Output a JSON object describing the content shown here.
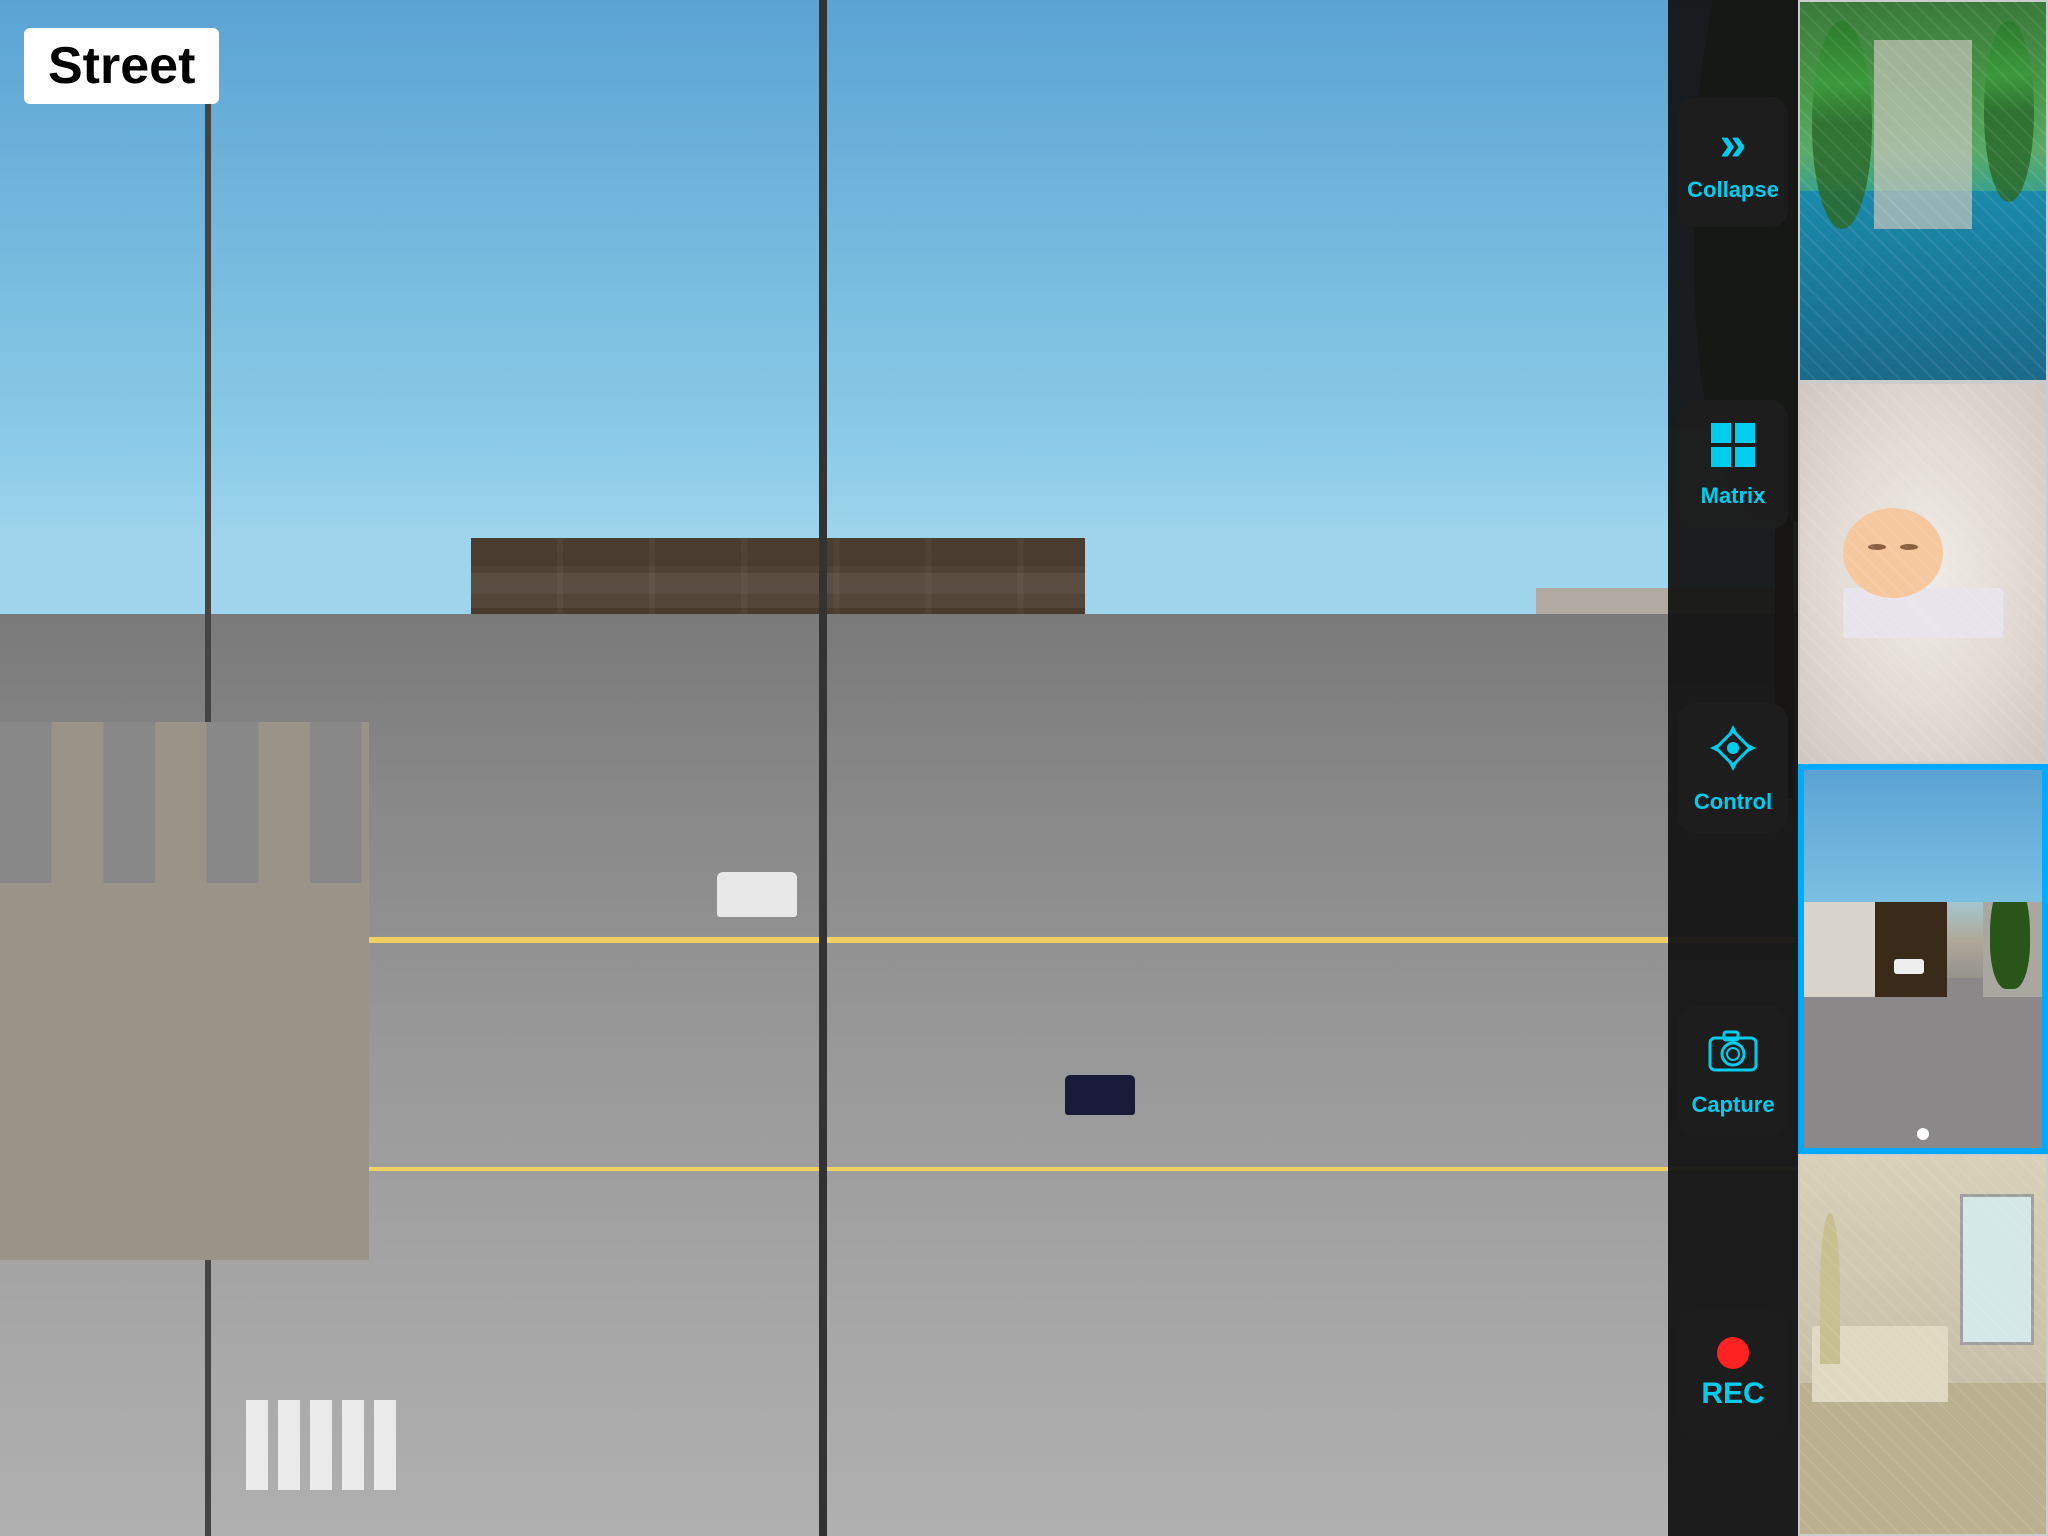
{
  "header": {
    "street_label": "Street"
  },
  "controls": [
    {
      "id": "collapse",
      "label": "Collapse",
      "icon": "chevron-right",
      "icon_unicode": "»"
    },
    {
      "id": "matrix",
      "label": "Matrix",
      "icon": "grid",
      "icon_unicode": "⊞"
    },
    {
      "id": "control",
      "label": "Control",
      "icon": "ptz",
      "icon_unicode": "◈"
    },
    {
      "id": "capture",
      "label": "Capture",
      "icon": "camera",
      "icon_unicode": "⊙"
    },
    {
      "id": "rec",
      "label": "REC",
      "icon": "record",
      "icon_unicode": "●"
    }
  ],
  "thumbnails": [
    {
      "id": "thumb-pool",
      "scene": "pool",
      "active": false
    },
    {
      "id": "thumb-baby",
      "scene": "baby",
      "active": false
    },
    {
      "id": "thumb-street",
      "scene": "street",
      "active": true
    },
    {
      "id": "thumb-room",
      "scene": "room",
      "active": false
    }
  ],
  "colors": {
    "accent": "#00ccee",
    "active_border": "#00aaff",
    "rec_dot": "#ff2222",
    "bg_dark": "#141414"
  }
}
